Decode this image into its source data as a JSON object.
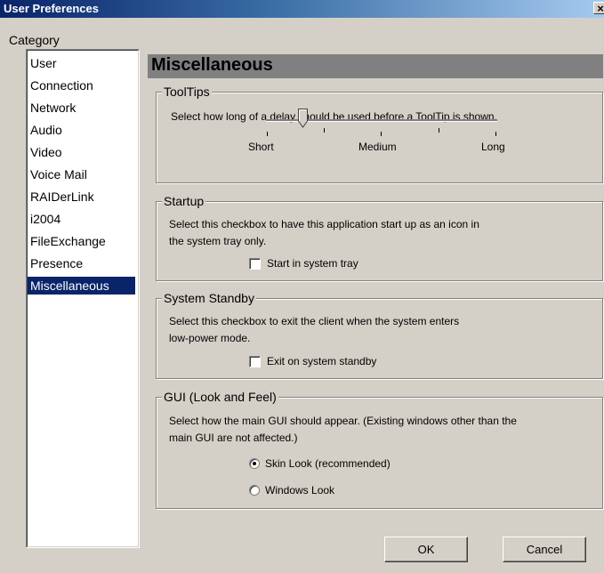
{
  "window": {
    "title": "User Preferences",
    "close_glyph": "×"
  },
  "category": {
    "label": "Category",
    "items": [
      {
        "label": "User"
      },
      {
        "label": "Connection"
      },
      {
        "label": "Network"
      },
      {
        "label": "Audio"
      },
      {
        "label": "Video"
      },
      {
        "label": "Voice Mail"
      },
      {
        "label": "RAIDerLink"
      },
      {
        "label": "i2004"
      },
      {
        "label": "FileExchange"
      },
      {
        "label": "Presence"
      },
      {
        "label": "Miscellaneous"
      }
    ],
    "selected": "Miscellaneous"
  },
  "panel": {
    "title": "Miscellaneous"
  },
  "tooltips": {
    "title": "ToolTips",
    "description": "Select how long of a delay should be used before a ToolTip is shown.",
    "labels": {
      "short": "Short",
      "medium": "Medium",
      "long": "Long"
    },
    "slider_value_fraction": 0.16
  },
  "startup": {
    "title": "Startup",
    "description_line1": "Select this checkbox to have this application start up as an icon in",
    "description_line2": "the system tray only.",
    "checkbox_label": "Start in system tray",
    "checked": false
  },
  "standby": {
    "title": "System Standby",
    "description_line1": "Select this checkbox to exit the client when the system enters",
    "description_line2": "low-power mode.",
    "checkbox_label": "Exit on system standby",
    "checked": false
  },
  "gui": {
    "title": "GUI (Look and Feel)",
    "description_line1": "Select how the main GUI should appear. (Existing windows other than the",
    "description_line2": "main GUI are not affected.)",
    "options": [
      {
        "label": "Skin Look (recommended)",
        "checked": true
      },
      {
        "label": "Windows Look",
        "checked": false
      }
    ]
  },
  "buttons": {
    "ok": "OK",
    "cancel": "Cancel"
  }
}
